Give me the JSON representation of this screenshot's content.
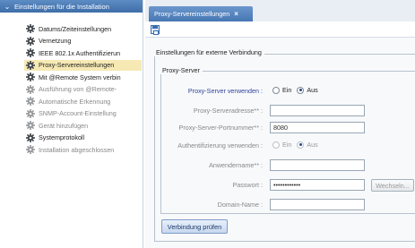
{
  "sidebar": {
    "header": "Einstellungen für die Installation",
    "items": [
      {
        "label": "Datums/Zeiteinstellungen",
        "icon": "gear-icon",
        "state": "normal"
      },
      {
        "label": "Vernetzung",
        "icon": "gear-icon",
        "state": "normal"
      },
      {
        "label": "IEEE 802.1x Authentifizierun",
        "icon": "gear-icon",
        "state": "normal"
      },
      {
        "label": "Proxy-Servereinstellungen",
        "icon": "gear-icon",
        "state": "selected"
      },
      {
        "label": "Mit @Remote System verbin",
        "icon": "gear-icon",
        "state": "normal"
      },
      {
        "label": "Ausführung von @Remote-",
        "icon": "gear-icon",
        "state": "dim"
      },
      {
        "label": "Automatische Erkennung",
        "icon": "gear-icon",
        "state": "dim"
      },
      {
        "label": "SNMP-Account-Einstellung",
        "icon": "gear-icon",
        "state": "dim"
      },
      {
        "label": "Gerät hinzufügen",
        "icon": "gear-icon",
        "state": "dim"
      },
      {
        "label": "Systemprotokoll",
        "icon": "gear-icon",
        "state": "normal"
      },
      {
        "label": "Installation abgeschlossen",
        "icon": "gear-icon",
        "state": "dim"
      }
    ]
  },
  "tab": {
    "label": "Proxy-Servereinstellungen",
    "close": "×"
  },
  "form": {
    "outer_legend": "Einstellungen für externe Verbindung",
    "inner_legend": "Proxy-Server",
    "use_proxy_label": "Proxy-Server verwenden :",
    "use_proxy_on": "Ein",
    "use_proxy_off": "Aus",
    "address_label": "Proxy-Serveradresse** :",
    "address_value": "",
    "port_label": "Proxy-Server-Portnummer** :",
    "port_value": "8080",
    "auth_label": "Authentifizierung verwenden :",
    "auth_on": "Ein",
    "auth_off": "Aus",
    "username_label": "Anwendername** :",
    "username_value": "",
    "password_label": "Passwort :",
    "password_value": "••••••••••••",
    "change_button": "Wechseln...",
    "domain_label": "Domain-Name :",
    "domain_value": "",
    "verify_button": "Verbindung prüfen"
  },
  "colors": {
    "header_blue": "#4677b3",
    "selected_bg": "#f6e9b4",
    "active_label": "#33439a"
  }
}
